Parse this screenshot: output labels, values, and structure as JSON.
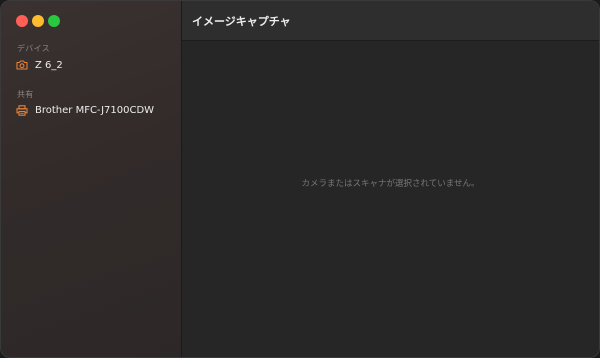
{
  "window": {
    "title": "イメージキャプチャ",
    "controls": {
      "close_color": "#ff5f57",
      "minimize_color": "#febc2e",
      "maximize_color": "#28c840"
    }
  },
  "sidebar": {
    "sections": [
      {
        "label": "デバイス",
        "items": [
          {
            "label": "Z 6_2",
            "icon": "camera-icon"
          }
        ]
      },
      {
        "label": "共有",
        "items": [
          {
            "label": "Brother MFC-J7100CDW",
            "icon": "printer-icon"
          }
        ]
      }
    ]
  },
  "main": {
    "empty_message": "カメラまたはスキャナが選択されていません。"
  },
  "colors": {
    "accent_icon": "#e5833a"
  }
}
